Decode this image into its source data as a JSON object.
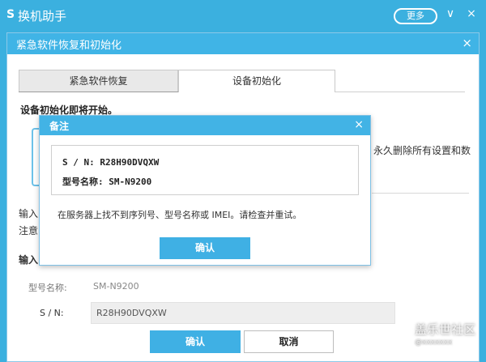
{
  "app": {
    "logo": "S",
    "title": "换机助手",
    "more_label": "更多",
    "minimize_glyph": "∨",
    "close_glyph": "×"
  },
  "dialog": {
    "title": "紧急软件恢复和初始化",
    "close_glyph": "×",
    "tabs": [
      {
        "label": "紧急软件恢复",
        "active": false
      },
      {
        "label": "设备初始化",
        "active": true
      }
    ],
    "heading": "设备初始化即将开始。",
    "right_text": "永久删除所有设置和数",
    "fragments": {
      "input1": "输入",
      "note": "注意",
      "input2": "输入"
    },
    "model_label": "型号名称:",
    "model_value": "SM-N9200",
    "sn_label": "S / N:",
    "sn_value": "R28H90DVQXW",
    "confirm_label": "确认",
    "cancel_label": "取消"
  },
  "modal": {
    "title": "备注",
    "close_glyph": "×",
    "sn_line": "S / N:  R28H90DVQXW",
    "model_line": "型号名称:  SM-N9200",
    "message": "在服务器上找不到序列号、型号名称或 IMEI。请检查并重试。",
    "confirm_label": "确认"
  },
  "watermark": {
    "text": "盖乐世社区",
    "sub": "@xxxxxxx"
  },
  "colors": {
    "accent": "#3bb0df",
    "button": "#3fb0e4"
  }
}
